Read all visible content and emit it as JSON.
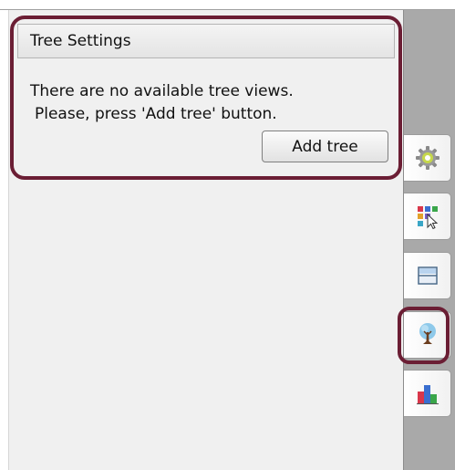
{
  "settings_panel": {
    "title": "Tree Settings",
    "message_line_1": "There are no available tree views.",
    "message_line_2": "Please, press 'Add tree' button.",
    "add_tree_label": "Add tree"
  },
  "side_tabs": [
    {
      "id": "settings",
      "icon": "gear-icon"
    },
    {
      "id": "layout",
      "icon": "grid-cursor-icon"
    },
    {
      "id": "panels",
      "icon": "panels-icon"
    },
    {
      "id": "tree",
      "icon": "tree-icon"
    },
    {
      "id": "chart",
      "icon": "bar-chart-icon"
    }
  ],
  "colors": {
    "highlight": "#6b1e34",
    "panel_background": "#f0f0f0",
    "tab_strip": "#a9a9a9"
  }
}
